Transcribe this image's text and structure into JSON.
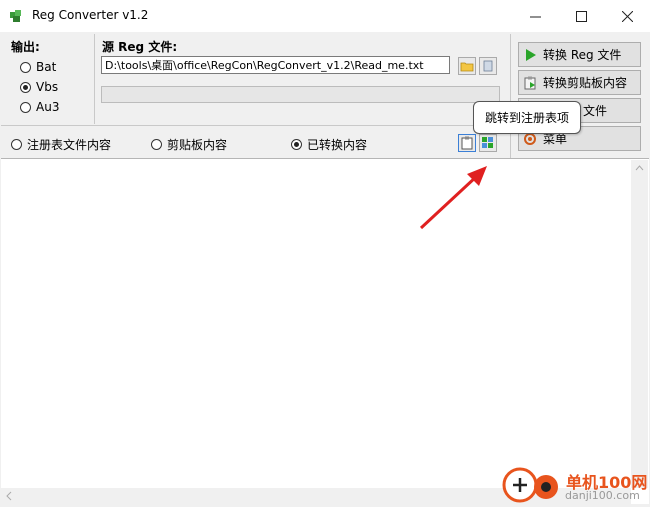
{
  "window": {
    "title": "Reg Converter v1.2"
  },
  "output_group": {
    "label": "输出:",
    "options": [
      {
        "label": "Bat",
        "selected": false
      },
      {
        "label": "Vbs",
        "selected": true
      },
      {
        "label": "Au3",
        "selected": false
      }
    ]
  },
  "source": {
    "label": "源 Reg 文件:",
    "path": "D:\\tools\\桌面\\office\\RegCon\\RegConvert_v1.2\\Read_me.txt"
  },
  "actions": {
    "convert_reg": "转换 Reg 文件",
    "convert_clipboard": "转换剪贴板内容",
    "save_file": "文件",
    "menu": "菜单"
  },
  "view_options": [
    {
      "label": "注册表文件内容",
      "selected": false
    },
    {
      "label": "剪贴板内容",
      "selected": false
    },
    {
      "label": "已转换内容",
      "selected": true
    }
  ],
  "tooltip": "跳转到注册表项",
  "watermark": {
    "line1": "单机100网",
    "line2": "danji100.com"
  },
  "colors": {
    "accent_green": "#2aa52a",
    "arrow_red": "#e02020",
    "watermark_orange": "#e8541d"
  }
}
